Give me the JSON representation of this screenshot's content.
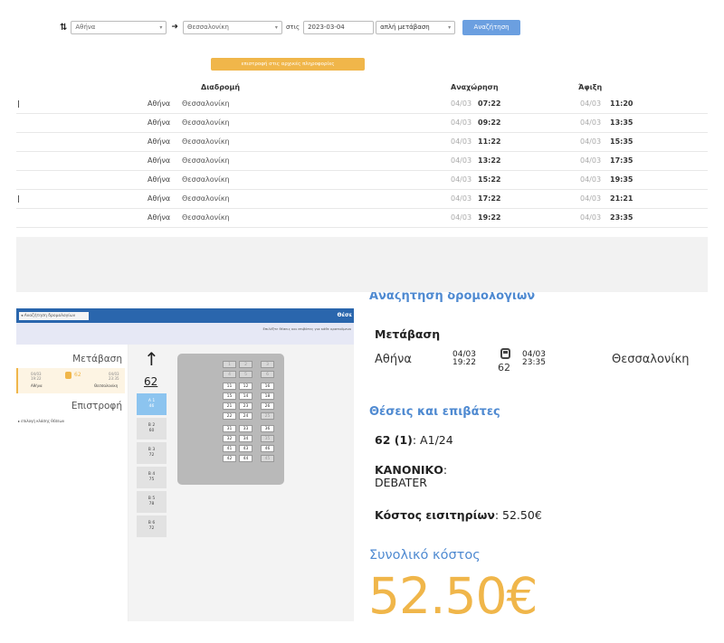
{
  "search": {
    "swap_icon": "swap-vertical-icon",
    "from_value": "Αθήνα",
    "arrow_icon": "arrow-right-icon",
    "to_value": "Θεσσαλονίκη",
    "date_label": "στις",
    "date_value": "2023-03-04",
    "trip_type": "απλή μετάβαση",
    "search_button": "Αναζήτηση"
  },
  "orange_button": "επιστροφή στις αρχικές πληροφορίες",
  "table": {
    "headers": {
      "route": "Διαδρομή",
      "departure": "Αναχώρηση",
      "arrival": "Άφιξη"
    },
    "rows": [
      {
        "from": "Αθήνα",
        "to": "Θεσσαλονίκη",
        "dep_date": "04/03",
        "dep_time": "07:22",
        "arr_date": "04/03",
        "arr_time": "11:20"
      },
      {
        "from": "Αθήνα",
        "to": "Θεσσαλονίκη",
        "dep_date": "04/03",
        "dep_time": "09:22",
        "arr_date": "04/03",
        "arr_time": "13:35"
      },
      {
        "from": "Αθήνα",
        "to": "Θεσσαλονίκη",
        "dep_date": "04/03",
        "dep_time": "11:22",
        "arr_date": "04/03",
        "arr_time": "15:35"
      },
      {
        "from": "Αθήνα",
        "to": "Θεσσαλονίκη",
        "dep_date": "04/03",
        "dep_time": "13:22",
        "arr_date": "04/03",
        "arr_time": "17:35"
      },
      {
        "from": "Αθήνα",
        "to": "Θεσσαλονίκη",
        "dep_date": "04/03",
        "dep_time": "15:22",
        "arr_date": "04/03",
        "arr_time": "19:35"
      },
      {
        "from": "Αθήνα",
        "to": "Θεσσαλονίκη",
        "dep_date": "04/03",
        "dep_time": "17:22",
        "arr_date": "04/03",
        "arr_time": "21:21"
      },
      {
        "from": "Αθήνα",
        "to": "Θεσσαλονίκη",
        "dep_date": "04/03",
        "dep_time": "19:22",
        "arr_date": "04/03",
        "arr_time": "23:35"
      }
    ]
  },
  "seatmap": {
    "back_button": "◂ Αναζήτηση δρομολογίων",
    "bar_title": "Θέσε",
    "subtitle": "Επιλέξτε θέσεις και επιβάτες για κάθε κρατούμενο",
    "leg_out_title": "Μετάβαση",
    "leg_out": {
      "dep_date": "04/03",
      "dep_time": "19:22",
      "train": "62",
      "arr_date": "04/03",
      "arr_time": "23:35",
      "from": "Αθήνα",
      "to": "Θεσσαλονίκη"
    },
    "leg_return_title": "Επιστροφή",
    "return_link": "▸ επιλογή κλάσης θέσεων",
    "direction_arrow": "↑",
    "train_number": "62",
    "cars": [
      {
        "label": "Α 1",
        "sub": "46"
      },
      {
        "label": "Β 2",
        "sub": "60"
      },
      {
        "label": "Β 3",
        "sub": "72"
      },
      {
        "label": "Β 4",
        "sub": "75"
      },
      {
        "label": "Β 5",
        "sub": "78"
      },
      {
        "label": "Β 6",
        "sub": "72"
      }
    ],
    "seats": [
      "1",
      "2",
      "3",
      "4",
      "5",
      "6",
      "11",
      "12",
      "16",
      "15",
      "14",
      "18",
      "21",
      "23",
      "26",
      "22",
      "24",
      "25",
      "31",
      "33",
      "36",
      "32",
      "34",
      "35",
      "41",
      "43",
      "46",
      "42",
      "44",
      "45"
    ]
  },
  "summary": {
    "cut_title": "Αναζήτηση δρομολογίων",
    "section1": "Μετάβαση",
    "from": "Αθήνα",
    "dep_date": "04/03",
    "dep_time": "19:22",
    "train_icon": "train-icon",
    "train": "62",
    "arr_date": "04/03",
    "arr_time": "23:35",
    "to": "Θεσσαλονίκη",
    "section2": "Θέσεις και επιβάτες",
    "seat_bold": "62 (1)",
    "seat_rest": ": A1/24",
    "fare_bold": "ΚΑΝΟΝΙΚΟ",
    "fare_colon": ":",
    "passenger": "DEBATER",
    "cost_label": "Κόστος εισιτηρίων",
    "cost_value": ": 52.50€",
    "total_title": "Συνολικό κόστος",
    "total_value": "52.50€"
  },
  "colors": {
    "blue": "#4f8ad1",
    "orange": "#f0b64a",
    "bar_blue": "#2a66ad",
    "total": "#f0b64a"
  }
}
